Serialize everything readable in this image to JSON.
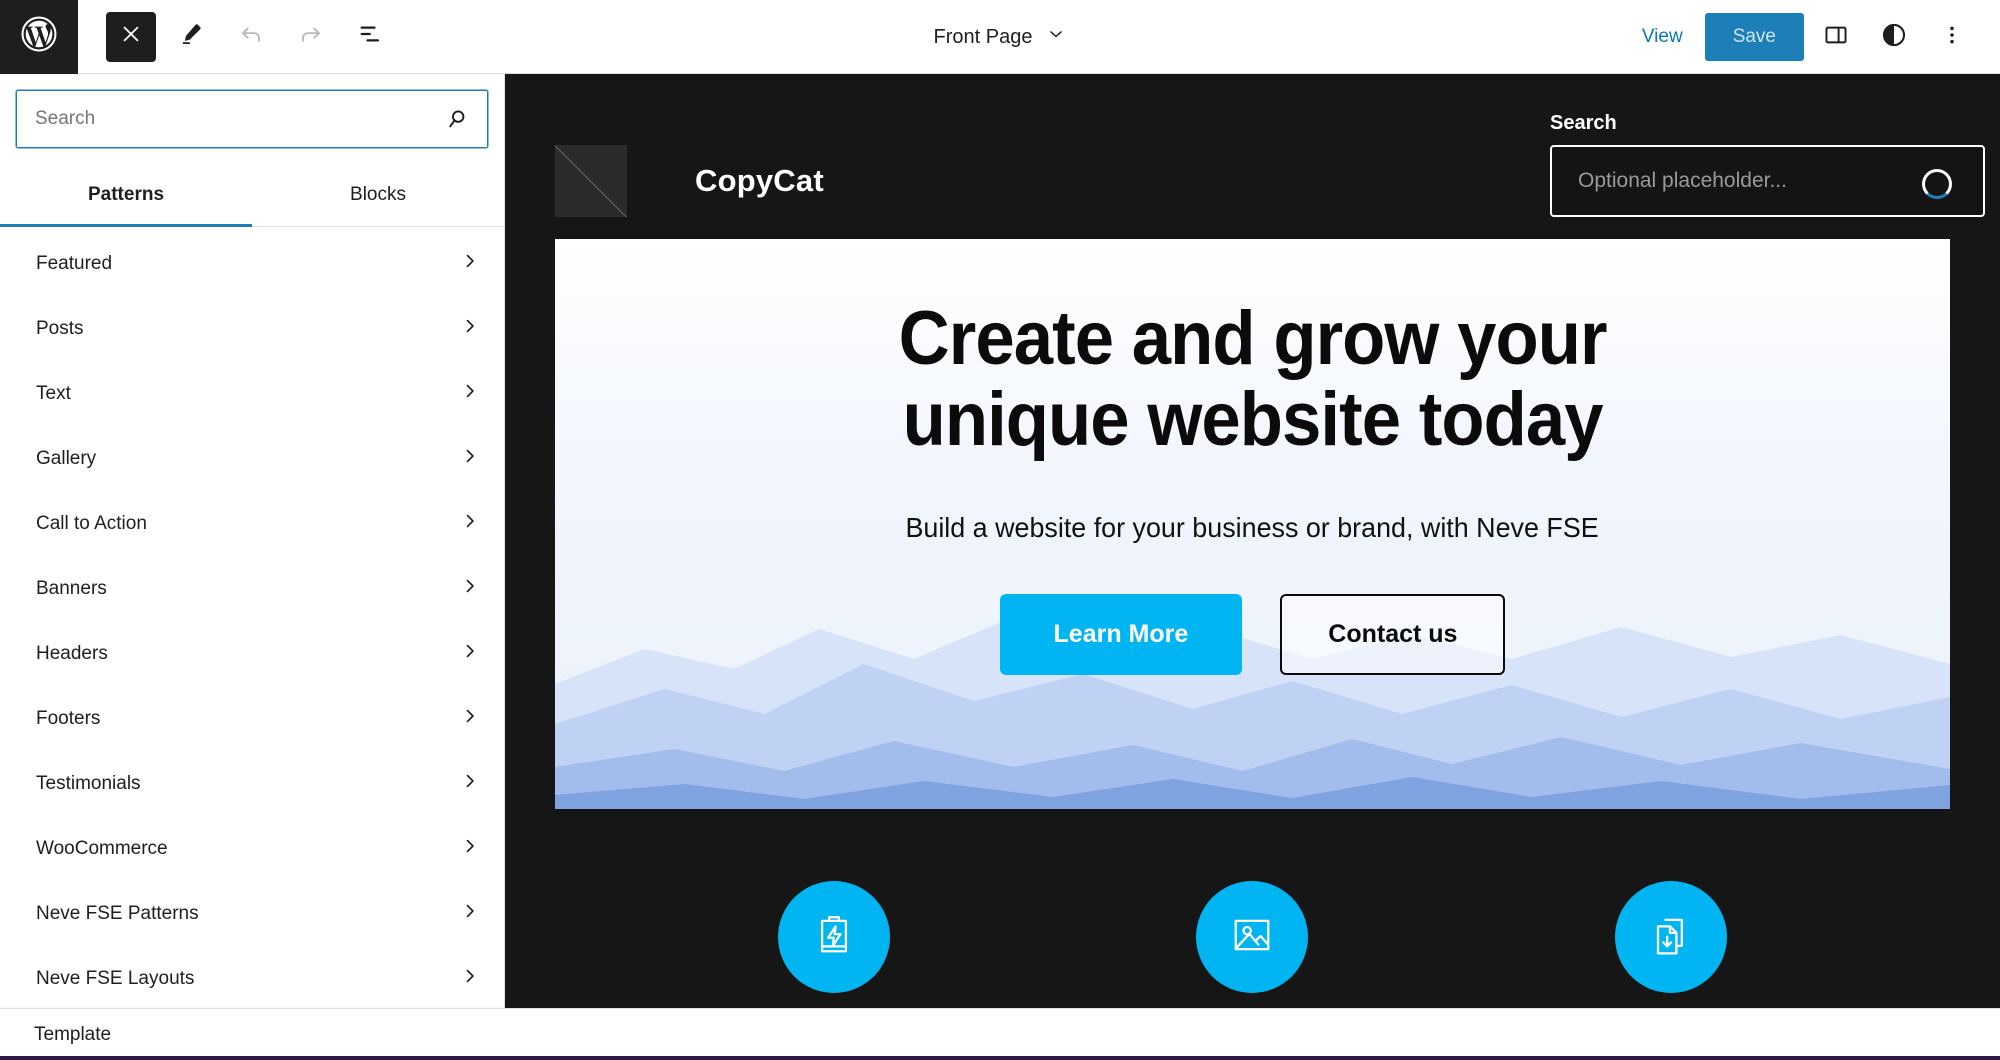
{
  "toolbar": {
    "wp_logo_icon": "wordpress-icon",
    "close_icon": "close-x-icon",
    "edit_icon": "pencil-edit-icon",
    "undo_icon": "undo-arrow-icon",
    "redo_icon": "redo-arrow-icon",
    "list_view_icon": "document-outline-icon",
    "document_title": "Front Page",
    "title_chevron_icon": "chevron-down-icon",
    "view_label": "View",
    "save_label": "Save",
    "sidebar_toggle_icon": "panel-right-icon",
    "styles_icon": "contrast-half-circle-icon",
    "options_icon": "more-vertical-dots-icon"
  },
  "inserter": {
    "search": {
      "value": "",
      "placeholder": "Search",
      "icon": "search-magnifier-icon"
    },
    "tabs": [
      {
        "label": "Patterns",
        "active": true
      },
      {
        "label": "Blocks",
        "active": false
      }
    ],
    "chevron_icon": "chevron-right-icon",
    "categories": [
      {
        "label": "Featured"
      },
      {
        "label": "Posts"
      },
      {
        "label": "Text"
      },
      {
        "label": "Gallery"
      },
      {
        "label": "Call to Action"
      },
      {
        "label": "Banners"
      },
      {
        "label": "Headers"
      },
      {
        "label": "Footers"
      },
      {
        "label": "Testimonials"
      },
      {
        "label": "WooCommerce"
      },
      {
        "label": "Neve FSE Patterns"
      },
      {
        "label": "Neve FSE Layouts"
      }
    ]
  },
  "canvas": {
    "site_header": {
      "logo_icon": "site-logo-placeholder-icon",
      "brand_name": "CopyCat",
      "search_label": "Search",
      "search_placeholder": "Optional placeholder...",
      "search_value": "",
      "search_button_icon": "search-magnifier-icon",
      "spinner_icon": "loading-spinner-icon"
    },
    "hero": {
      "heading_line1": "Create and grow your",
      "heading_line2": "unique website today",
      "subheading": "Build a website for your business or brand, with Neve FSE",
      "primary_button": "Learn More",
      "outline_button": "Contact us"
    },
    "features": [
      {
        "icon": "battery-charging-icon"
      },
      {
        "icon": "image-photo-icon"
      },
      {
        "icon": "documents-download-icon"
      }
    ]
  },
  "statusbar": {
    "label": "Template"
  },
  "colors": {
    "accent_cyan": "#00b5f2",
    "wp_blue": "#1d7fb8",
    "dark_bg": "#161616",
    "toolbar_dark": "#1e1e1e"
  }
}
